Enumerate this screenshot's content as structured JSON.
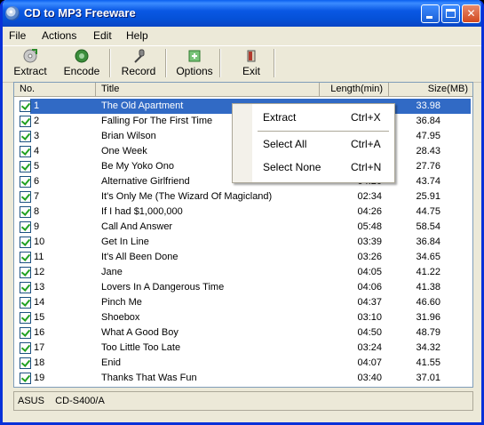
{
  "window": {
    "title": "CD to MP3 Freeware"
  },
  "menu": [
    {
      "label": "File"
    },
    {
      "label": "Actions"
    },
    {
      "label": "Edit"
    },
    {
      "label": "Help"
    }
  ],
  "toolbar": {
    "extract": "Extract",
    "encode": "Encode",
    "record": "Record",
    "options": "Options",
    "exit": "Exit"
  },
  "columns": {
    "no": "No.",
    "title": "Title",
    "length": "Length(min)",
    "size": "Size(MB)"
  },
  "tracks": [
    {
      "no": "1",
      "title": "The Old Apartment",
      "length": "",
      "size": "33.98",
      "checked": true,
      "selected": true
    },
    {
      "no": "2",
      "title": "Falling For The First Time",
      "length": "",
      "size": "36.84",
      "checked": true
    },
    {
      "no": "3",
      "title": "Brian Wilson",
      "length": "",
      "size": "47.95",
      "checked": true
    },
    {
      "no": "4",
      "title": "One Week",
      "length": "",
      "size": "28.43",
      "checked": true
    },
    {
      "no": "5",
      "title": "Be My Yoko Ono",
      "length": "",
      "size": "27.76",
      "checked": true
    },
    {
      "no": "6",
      "title": "Alternative Girlfriend",
      "length": "04:20",
      "size": "43.74",
      "checked": true
    },
    {
      "no": "7",
      "title": "It's Only Me (The Wizard Of Magicland)",
      "length": "02:34",
      "size": "25.91",
      "checked": true
    },
    {
      "no": "8",
      "title": "If I had $1,000,000",
      "length": "04:26",
      "size": "44.75",
      "checked": true
    },
    {
      "no": "9",
      "title": "Call And Answer",
      "length": "05:48",
      "size": "58.54",
      "checked": true
    },
    {
      "no": "10",
      "title": "Get In Line",
      "length": "03:39",
      "size": "36.84",
      "checked": true
    },
    {
      "no": "11",
      "title": "It's All Been Done",
      "length": "03:26",
      "size": "34.65",
      "checked": true
    },
    {
      "no": "12",
      "title": "Jane",
      "length": "04:05",
      "size": "41.22",
      "checked": true
    },
    {
      "no": "13",
      "title": "Lovers In A Dangerous Time",
      "length": "04:06",
      "size": "41.38",
      "checked": true
    },
    {
      "no": "14",
      "title": "Pinch Me",
      "length": "04:37",
      "size": "46.60",
      "checked": true
    },
    {
      "no": "15",
      "title": "Shoebox",
      "length": "03:10",
      "size": "31.96",
      "checked": true
    },
    {
      "no": "16",
      "title": "What A Good Boy",
      "length": "04:50",
      "size": "48.79",
      "checked": true
    },
    {
      "no": "17",
      "title": "Too Little Too Late",
      "length": "03:24",
      "size": "34.32",
      "checked": true
    },
    {
      "no": "18",
      "title": "Enid",
      "length": "04:07",
      "size": "41.55",
      "checked": true
    },
    {
      "no": "19",
      "title": "Thanks That Was Fun",
      "length": "03:40",
      "size": "37.01",
      "checked": true
    }
  ],
  "context_menu": [
    {
      "label": "Extract",
      "shortcut": "Ctrl+X"
    },
    {
      "label": "Select All",
      "shortcut": "Ctrl+A"
    },
    {
      "label": "Select None",
      "shortcut": "Ctrl+N"
    }
  ],
  "status": {
    "drive": "ASUS    CD-S400/A"
  },
  "colors": {
    "selection": "#316AC5",
    "titlebar": "#0A58E4",
    "face": "#ECE9D8"
  }
}
